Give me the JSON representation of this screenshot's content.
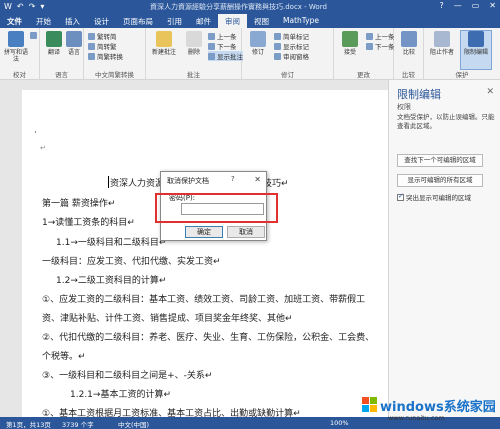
{
  "window": {
    "title": "資深人力資源經驗分享薪酬操作實務與技巧.docx - Word",
    "qat": [
      "W",
      "↶",
      "↷",
      "▾"
    ],
    "controls": [
      "?",
      "—",
      "▭",
      "✕"
    ]
  },
  "tabs": [
    "文件",
    "开始",
    "插入",
    "设计",
    "页面布局",
    "引用",
    "邮件",
    "审阅",
    "视图",
    "MathType"
  ],
  "active_tab": "审阅",
  "ribbon": {
    "groups": [
      {
        "label": "校对",
        "buttons": [
          "拼写和语法",
          "字数统计"
        ]
      },
      {
        "label": "语言",
        "buttons": [
          "翻译",
          "语言"
        ]
      },
      {
        "label": "中文简繁转换",
        "buttons": [
          "繁转简",
          "简转繁",
          "简繁转换"
        ]
      },
      {
        "label": "批注",
        "buttons": [
          "新建批注",
          "删除",
          "上一条",
          "下一条",
          "显示批注"
        ]
      },
      {
        "label": "修订",
        "buttons": [
          "修订",
          "简单标记",
          "显示标记",
          "审阅窗格"
        ]
      },
      {
        "label": "更改",
        "buttons": [
          "接受",
          "上一条",
          "下一条"
        ]
      },
      {
        "label": "比较",
        "buttons": [
          "比较"
        ]
      },
      {
        "label": "保护",
        "buttons": [
          "阻止作者",
          "限制编辑"
        ]
      }
    ]
  },
  "document": {
    "lines": [
      "·",
      "↵",
      "资深人力资源经验分享薪酬操作实务与技巧↵",
      "第一篇  薪资操作↵",
      "1→读懂工资条的科目↵",
      "1.1→一级科目和二级科目↵",
      "一级科目：应发工资、代扣代缴、实发工资↵",
      "1.2→二级工资科目的计算↵",
      "①、应发工资的二级科目：基本工资、绩效工资、司龄工资、加班工资、带薪假工",
      "资、津贴补贴、计件工资、销售提成、项目奖金年终奖、其他↵",
      "②、代扣代缴的二级科目：养老、医疗、失业、生育、工伤保险，公积金、工会费、",
      "个税等。↵",
      "③、一级科目和二级科目之间是+、-关系↵",
      "1.2.1→基本工资的计算↵",
      "①、基本工资根据月工资标准、基本工资占比、出勤或缺勤计算↵"
    ]
  },
  "dialog": {
    "title": "取消保护文档",
    "help": "?",
    "close": "✕",
    "password_label": "密码(P):",
    "password_value": "",
    "ok": "确定",
    "cancel": "取消"
  },
  "pane": {
    "title": "限制编辑",
    "close": "✕",
    "section": "权限",
    "text": "文档受保护，以防止误编辑。只能查看此区域。",
    "buttons": [
      "查找下一个可编辑的区域",
      "显示可编辑的所有区域"
    ],
    "checkbox": "突出显示可编辑的区域"
  },
  "status": {
    "page": "第1页，共13页",
    "words": "3739 个字",
    "lang": "中文(中国)",
    "zoom": "100%"
  },
  "watermark": {
    "text": "windows系统家园",
    "sub": "www.runaitu.com"
  },
  "colors": {
    "accent": "#2b579a",
    "highlight": "#e03030"
  }
}
